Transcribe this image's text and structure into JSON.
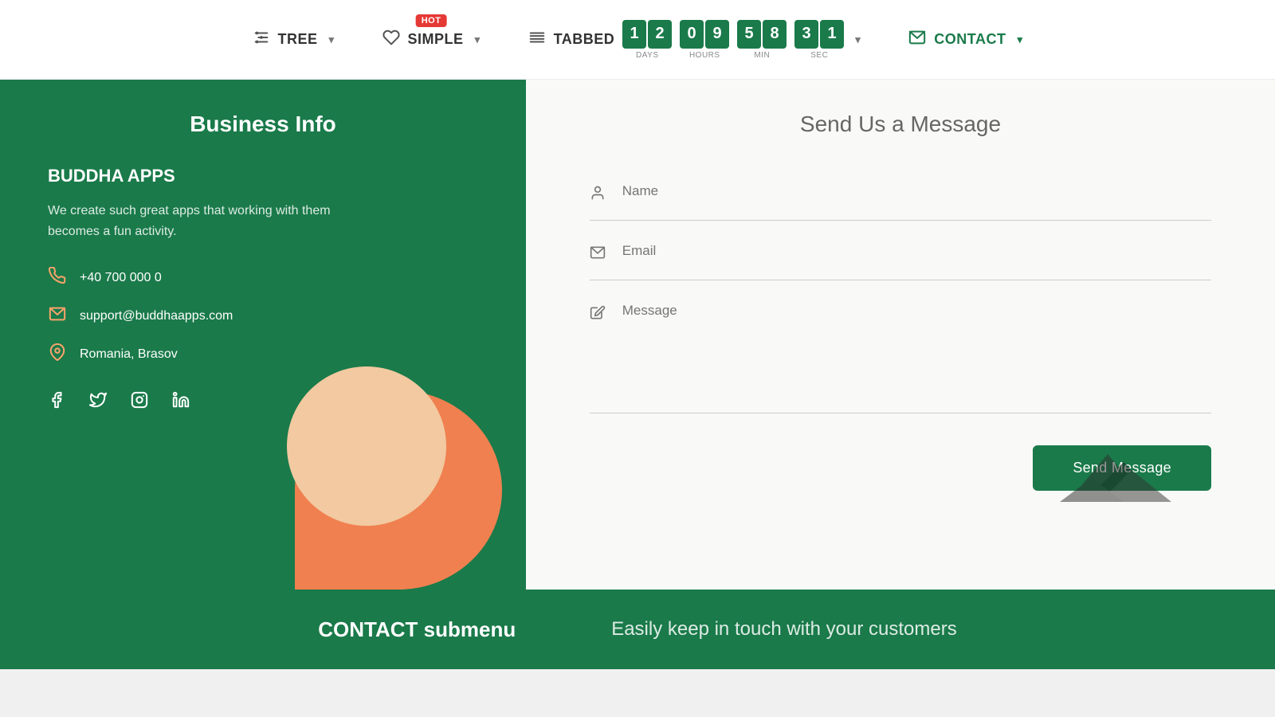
{
  "navbar": {
    "tree_label": "TREE",
    "simple_label": "SIMPLE",
    "hot_badge": "HOT",
    "tabbed_label": "TABBED",
    "contact_label": "CONTACT",
    "countdown": {
      "days": [
        "1",
        "2"
      ],
      "hours": [
        "0",
        "9"
      ],
      "minutes": [
        "5",
        "8"
      ],
      "seconds": [
        "3",
        "1"
      ],
      "days_label": "DAYS",
      "hours_label": "HOURS",
      "min_label": "MIN",
      "sec_label": "SEC"
    }
  },
  "business": {
    "panel_title": "Business Info",
    "company_name": "BUDDHA APPS",
    "description": "We create such great apps that working with them becomes a fun activity.",
    "phone": "+40 700 000 0",
    "email": "support@buddhaapps.com",
    "location": "Romania, Brasov"
  },
  "form": {
    "title": "Send Us a Message",
    "name_placeholder": "Name",
    "email_placeholder": "Email",
    "message_placeholder": "Message",
    "send_button": "Send Message"
  },
  "footer": {
    "title": "CONTACT submenu",
    "description": "Easily keep in touch with your customers"
  }
}
